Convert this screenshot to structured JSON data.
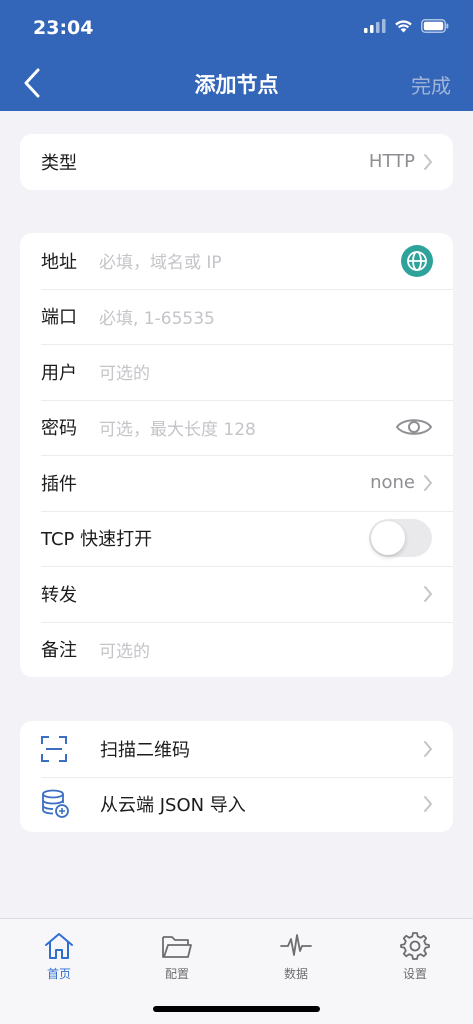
{
  "status_bar": {
    "time": "23:04"
  },
  "nav": {
    "title": "添加节点",
    "done_label": "完成"
  },
  "type_row": {
    "label": "类型",
    "value": "HTTP"
  },
  "form": {
    "address": {
      "label": "地址",
      "placeholder": "必填，域名或 IP"
    },
    "port": {
      "label": "端口",
      "placeholder": "必填, 1-65535"
    },
    "user": {
      "label": "用户",
      "placeholder": "可选的"
    },
    "password": {
      "label": "密码",
      "placeholder": "可选，最大长度 128"
    },
    "plugin": {
      "label": "插件",
      "value": "none"
    },
    "tcp_fast_open": {
      "label": "TCP 快速打开",
      "enabled": false
    },
    "forward": {
      "label": "转发"
    },
    "note": {
      "label": "备注",
      "placeholder": "可选的"
    }
  },
  "actions": {
    "scan_qr": {
      "label": "扫描二维码"
    },
    "import_json": {
      "label": "从云端 JSON 导入"
    }
  },
  "tabbar": {
    "tabs": [
      {
        "label": "首页",
        "icon": "home-icon",
        "active": true
      },
      {
        "label": "配置",
        "icon": "folder-icon",
        "active": false
      },
      {
        "label": "数据",
        "icon": "activity-icon",
        "active": false
      },
      {
        "label": "设置",
        "icon": "gear-icon",
        "active": false
      }
    ]
  },
  "colors": {
    "header": "#3366b8",
    "accent": "#2f6fd0",
    "globe": "#2fa39b"
  }
}
